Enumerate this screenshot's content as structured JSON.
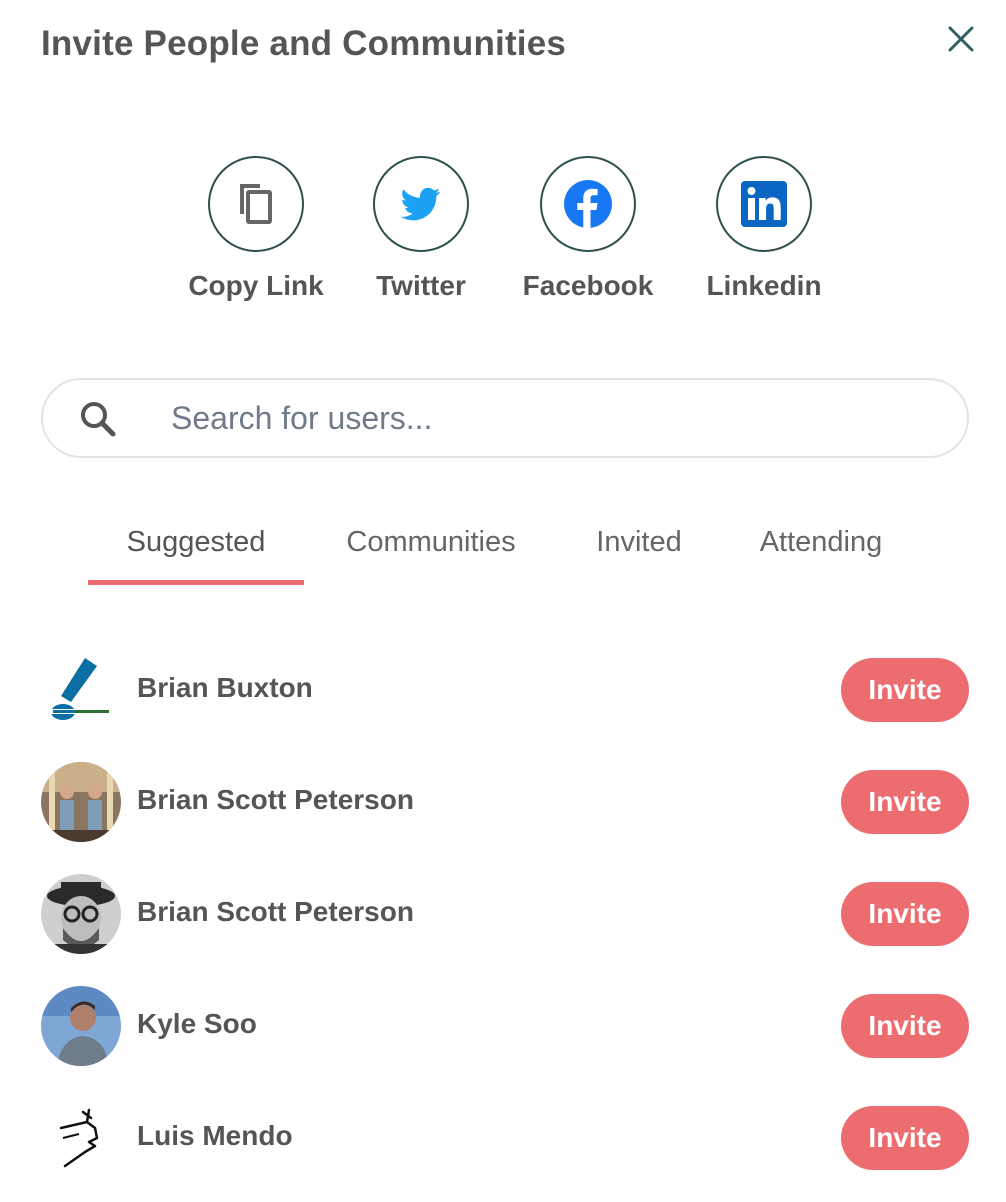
{
  "title": "Invite People and Communities",
  "share": [
    {
      "label": "Copy Link",
      "icon": "copy-icon"
    },
    {
      "label": "Twitter",
      "icon": "twitter-icon"
    },
    {
      "label": "Facebook",
      "icon": "facebook-icon"
    },
    {
      "label": "Linkedin",
      "icon": "linkedin-icon"
    }
  ],
  "search": {
    "placeholder": "Search for users..."
  },
  "tabs": [
    {
      "label": "Suggested",
      "active": true
    },
    {
      "label": "Communities",
      "active": false
    },
    {
      "label": "Invited",
      "active": false
    },
    {
      "label": "Attending",
      "active": false
    }
  ],
  "users": [
    {
      "name": "Brian Buxton",
      "action": "Invite"
    },
    {
      "name": "Brian Scott Peterson",
      "action": "Invite"
    },
    {
      "name": "Brian Scott Peterson",
      "action": "Invite"
    },
    {
      "name": "Kyle Soo",
      "action": "Invite"
    },
    {
      "name": "Luis Mendo",
      "action": "Invite"
    }
  ],
  "colors": {
    "accent": "#ec6c6f",
    "text": "#555555",
    "border": "#2f4f4f",
    "twitter": "#1da1f2",
    "facebook": "#1877f2",
    "linkedin": "#0a66c2"
  }
}
